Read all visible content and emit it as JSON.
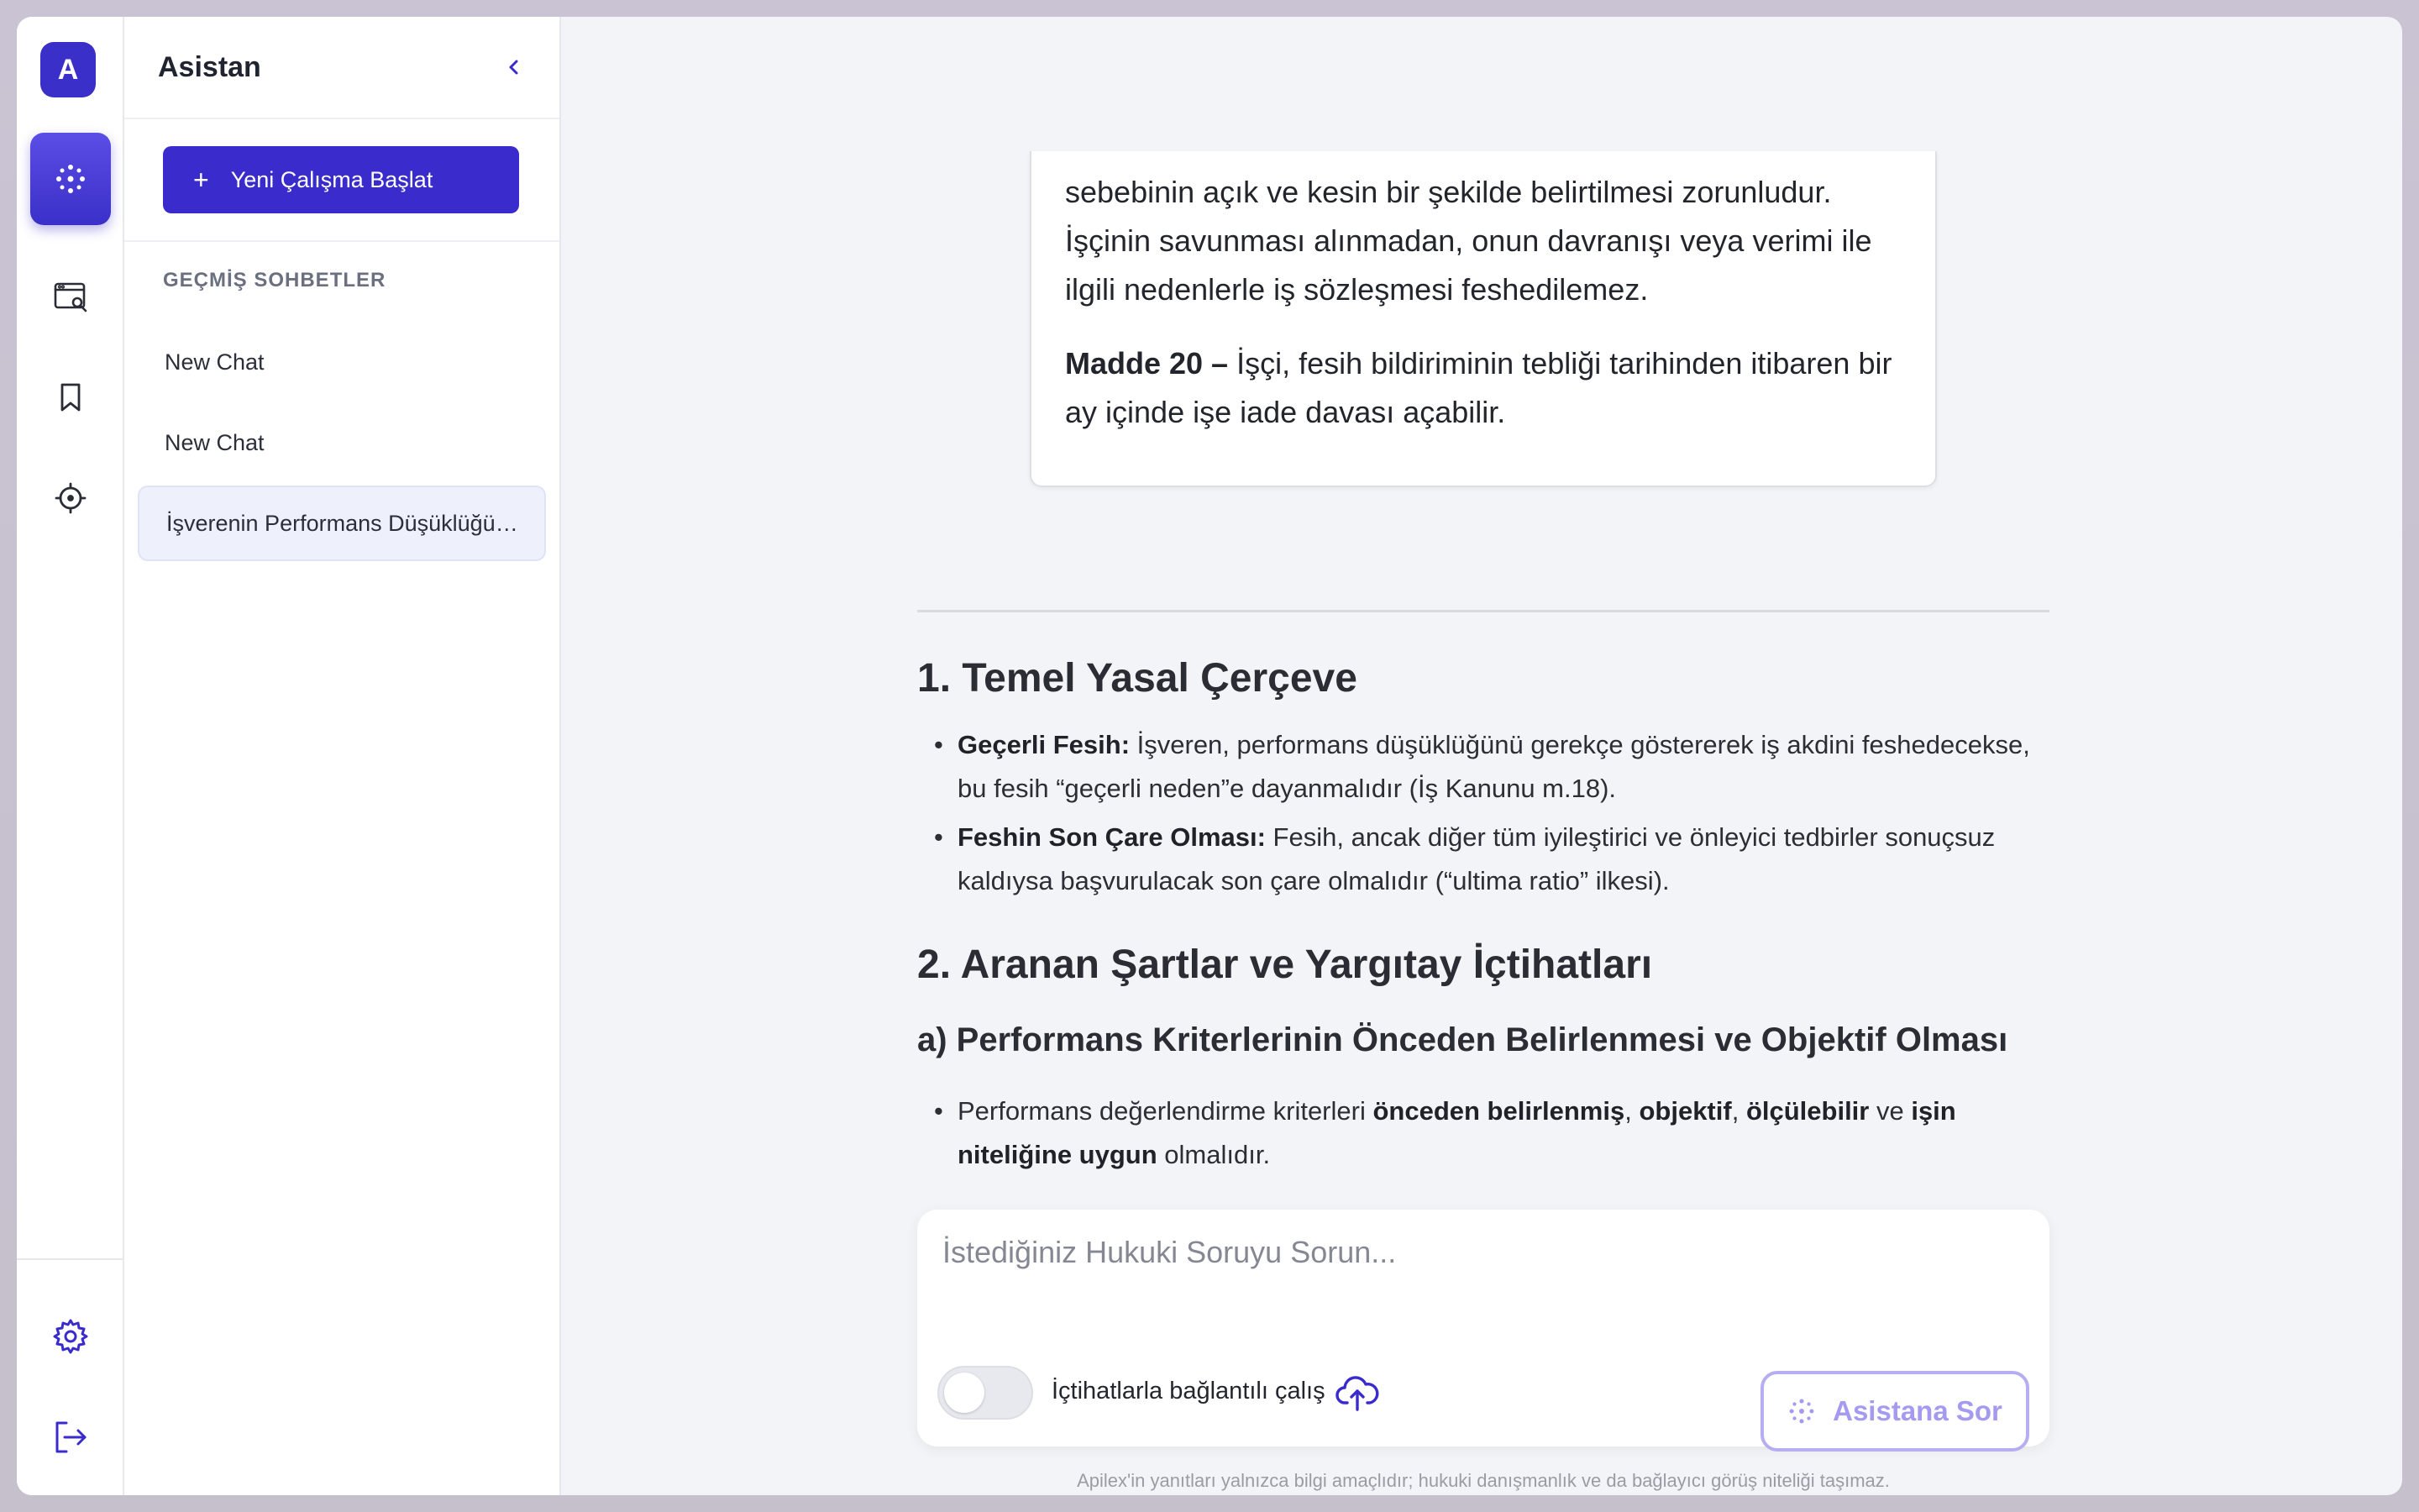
{
  "app": {
    "logo_letter": "A"
  },
  "rail": {
    "items": [
      "assistant-icon",
      "search-document-icon",
      "bookmark-icon",
      "target-icon"
    ],
    "bottom": [
      "settings-icon",
      "logout-icon"
    ]
  },
  "sidebar": {
    "title": "Asistan",
    "new_button": "Yeni Çalışma Başlat",
    "section_label": "GEÇMİŞ SOHBETLER",
    "chats": [
      {
        "label": "New Chat"
      },
      {
        "label": "New Chat"
      },
      {
        "label": "İşverenin Performans Düşüklüğü Gerekçesiyle Fesih"
      }
    ]
  },
  "quote": {
    "p1": "sebebinin açık ve kesin bir şekilde belirtilmesi zorunludur. İşçinin savunması alınmadan, onun davranışı veya verimi ile ilgili nedenlerle iş sözleşmesi feshedilemez.",
    "p2_bold": "Madde 20 –",
    "p2": " İşçi, fesih bildiriminin tebliği tarihinden itibaren bir ay içinde işe iade davası açabilir."
  },
  "content": {
    "h1": "1. Temel Yasal Çerçeve",
    "b1_bold": "Geçerli Fesih:",
    "b1": " İşveren, performans düşüklüğünü gerekçe göstererek iş akdini feshedecekse, bu fesih “geçerli neden”e dayanmalıdır (İş Kanunu m.18).",
    "b2_bold": "Feshin Son Çare Olması:",
    "b2": " Fesih, ancak diğer tüm iyileştirici ve önleyici tedbirler sonuçsuz kaldıysa başvurulacak son çare olmalıdır (“ultima ratio” ilkesi).",
    "h2": "2. Aranan Şartlar ve Yargıtay İçtihatları",
    "h3": "a) Performans Kriterlerinin Önceden Belirlenmesi ve Objektif Olması",
    "b3_a": "Performans değerlendirme kriterleri ",
    "b3_b": "önceden belirlenmiş",
    "b3_c": ", ",
    "b3_d": "objektif",
    "b3_e": ", ",
    "b3_f": "ölçülebilir",
    "b3_g": " ve ",
    "b3_h": "işin niteliğine uygun",
    "b3_i": " olmalıdır."
  },
  "composer": {
    "placeholder": "İstediğiniz Hukuki Soruyu Sorun...",
    "toggle_label": "İçtihatlarla bağlantılı çalış",
    "toggle_on": false,
    "submit_label": "Asistana Sor"
  },
  "disclaimer": "Apilex'in yanıtları yalnızca bilgi amaçlıdır; hukuki danışmanlık ve da bağlayıcı görüş niteliği taşımaz.",
  "colors": {
    "accent": "#3a2ccc",
    "accent_light": "#b7aef2"
  }
}
